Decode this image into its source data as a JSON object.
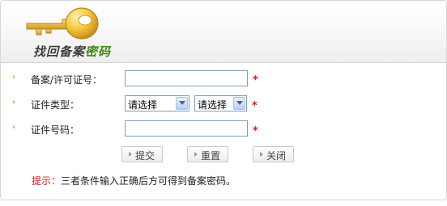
{
  "header": {
    "title_part1": "找回备案",
    "title_part2": "密码",
    "icon": "key-icon"
  },
  "form": {
    "fields": [
      {
        "label": "备案/许可证号：",
        "value": "",
        "required_mark": "*"
      },
      {
        "label": "证件类型：",
        "select1": "请选择",
        "select2": "请选择",
        "required_mark": "*"
      },
      {
        "label": "证件号码：",
        "value": "",
        "required_mark": "*"
      }
    ]
  },
  "buttons": {
    "submit": "提交",
    "reset": "重置",
    "close": "关闭"
  },
  "hint": {
    "label": "提示：",
    "text": "三者条件输入正确后方可得到备案密码。"
  },
  "colors": {
    "accent": "#3f8a12",
    "required": "#e02020",
    "arrow": "#d59b1e",
    "key": "#f1c232"
  }
}
